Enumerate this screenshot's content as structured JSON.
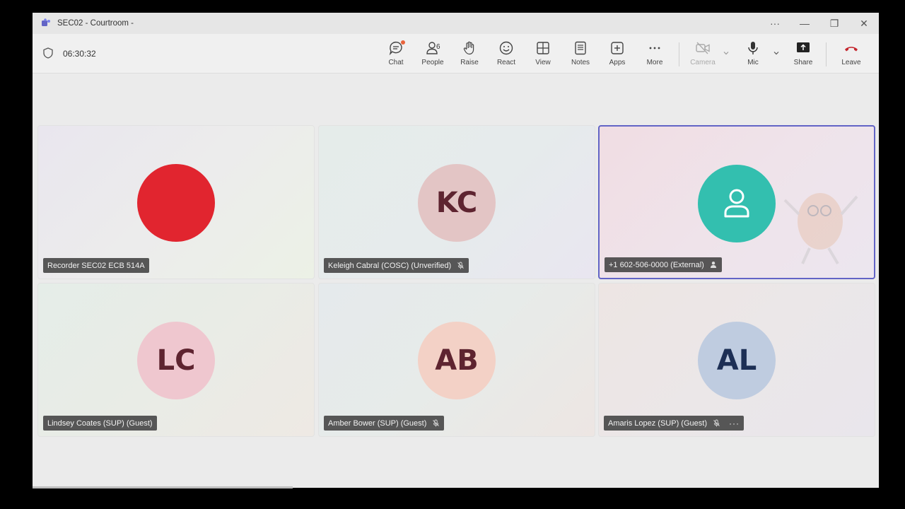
{
  "window": {
    "title": "SEC02 - Courtroom -",
    "controls": [
      "···",
      "—",
      "❐",
      "✕"
    ]
  },
  "toolbar": {
    "timer": "06:30:32",
    "buttons": {
      "chat": "Chat",
      "people": "People",
      "people_count": "6",
      "raise": "Raise",
      "react": "React",
      "view": "View",
      "notes": "Notes",
      "apps": "Apps",
      "more": "More",
      "camera": "Camera",
      "mic": "Mic",
      "share": "Share",
      "leave": "Leave"
    }
  },
  "participants": [
    {
      "name": "Recorder SEC02 ECB 514A",
      "initials": "",
      "avatar_color": "#e1252f",
      "muted": false
    },
    {
      "name": "Keleigh Cabral (COSC) (Unverified)",
      "initials": "KC",
      "avatar_color": "#e3c5c5",
      "muted": true
    },
    {
      "name": "+1 602-506-0000 (External)",
      "initials": "",
      "avatar_color": "#33bfaf",
      "muted": false,
      "active": true
    },
    {
      "name": "Lindsey Coates (SUP) (Guest)",
      "initials": "LC",
      "avatar_color": "#efc7cf",
      "muted": false
    },
    {
      "name": "Amber Bower (SUP) (Guest)",
      "initials": "AB",
      "avatar_color": "#f3d1c6",
      "muted": true
    },
    {
      "name": "Amaris Lopez (SUP) (Guest)",
      "initials": "AL",
      "avatar_color": "#bfcce0",
      "muted": true
    }
  ],
  "colors": {
    "accent": "#6264c6",
    "leave": "#c4262e"
  }
}
